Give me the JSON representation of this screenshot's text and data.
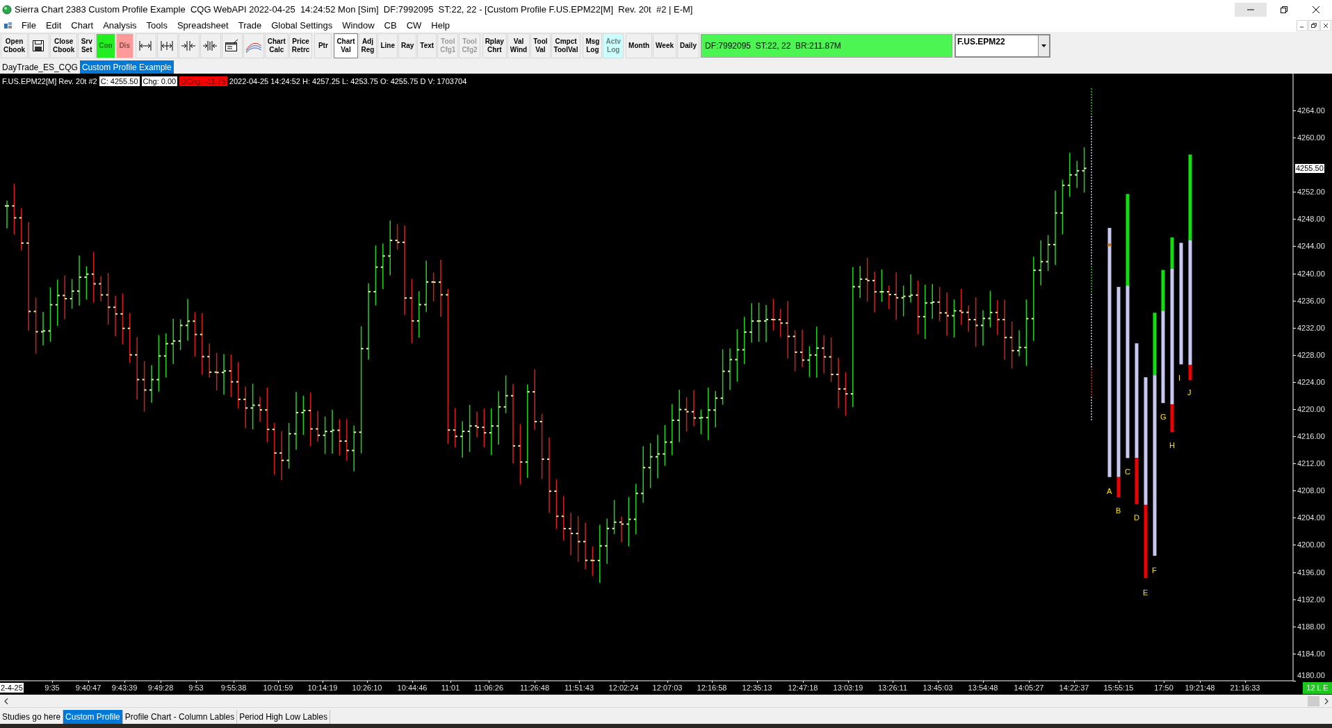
{
  "window": {
    "title": "Sierra Chart 2383 Custom Profile Example  CQG WebAPI 2022-04-25  14:24:52 Mon [Sim]  DF:7992095  ST:22, 22 - [Custom Profile F.US.EPM22[M]  Rev. 20t  #2 | E-M]"
  },
  "menu": [
    "File",
    "Edit",
    "Chart",
    "Analysis",
    "Tools",
    "Spreadsheet",
    "Trade",
    "Global Settings",
    "Window",
    "CB",
    "CW",
    "Help"
  ],
  "toolbar": {
    "groups": [
      [
        {
          "kind": "text",
          "label": "Open\nCbook",
          "pressed": false,
          "disabled": false
        },
        {
          "kind": "floppy"
        },
        {
          "kind": "text",
          "label": "Close\nCbook",
          "pressed": false,
          "disabled": false
        },
        {
          "kind": "text",
          "label": "Srv\nSet",
          "pressed": false,
          "disabled": false
        },
        {
          "kind": "text",
          "label": "Con",
          "pressed": false,
          "disabled": false,
          "color": "#22ee22"
        },
        {
          "kind": "text",
          "label": "Dis",
          "pressed": false,
          "disabled": false,
          "color": "#ff9a9a"
        }
      ],
      [
        {
          "kind": "spanout"
        },
        {
          "kind": "spanbar"
        },
        {
          "kind": "squeeze"
        },
        {
          "kind": "squeezebar"
        },
        {
          "kind": "form"
        },
        {
          "kind": "arcs"
        },
        {
          "kind": "text",
          "label": "Chart\nCalc",
          "pressed": false,
          "disabled": false
        },
        {
          "kind": "text",
          "label": "Price\nRetrc",
          "pressed": false,
          "disabled": false
        }
      ],
      [
        {
          "kind": "text",
          "label": "Ptr",
          "pressed": false,
          "disabled": false
        }
      ],
      [
        {
          "kind": "text",
          "label": "Chart\nVal",
          "pressed": true,
          "disabled": false
        },
        {
          "kind": "text",
          "label": "Adj\nReg",
          "pressed": false,
          "disabled": false
        },
        {
          "kind": "text",
          "label": "Line",
          "pressed": false,
          "disabled": false
        },
        {
          "kind": "text",
          "label": "Ray",
          "pressed": false,
          "disabled": false
        },
        {
          "kind": "text",
          "label": "Text",
          "pressed": false,
          "disabled": false
        },
        {
          "kind": "text",
          "label": "Tool\nCfg1",
          "pressed": false,
          "disabled": true
        },
        {
          "kind": "text",
          "label": "Tool\nCfg2",
          "pressed": false,
          "disabled": true
        }
      ],
      [
        {
          "kind": "text",
          "label": "Rplay\nChrt",
          "pressed": false,
          "disabled": false
        },
        {
          "kind": "text",
          "label": "Val\nWind",
          "pressed": false,
          "disabled": false
        },
        {
          "kind": "text",
          "label": "Tool\nVal",
          "pressed": false,
          "disabled": false
        },
        {
          "kind": "text",
          "label": "Cmpct\nToolVal",
          "pressed": false,
          "disabled": false
        }
      ],
      [
        {
          "kind": "text",
          "label": "Msg\nLog",
          "pressed": false,
          "disabled": false
        },
        {
          "kind": "text",
          "label": "Actv\nLog",
          "pressed": false,
          "disabled": false,
          "color": "#ccffff"
        }
      ],
      [
        {
          "kind": "text",
          "label": "Month",
          "pressed": false,
          "disabled": false
        },
        {
          "kind": "text",
          "label": "Week",
          "pressed": false,
          "disabled": false
        },
        {
          "kind": "text",
          "label": "Daily",
          "pressed": false,
          "disabled": false
        }
      ]
    ]
  },
  "status_field": "DF:7992095  ST:22, 22  BR:211.87M",
  "symbol_dropdown": {
    "value": "F.US.EPM22"
  },
  "chart_tabs": [
    {
      "label": "DayTrade_ES_CQG",
      "selected": false
    },
    {
      "label": "Custom Profile Example",
      "selected": true
    }
  ],
  "chart": {
    "header": [
      {
        "text": "F.US.EPM22[M]",
        "kind": "plain"
      },
      {
        "text": "Rev. 20t #2",
        "kind": "plain"
      },
      {
        "text": "C: 4255.50",
        "kind": "boxed"
      },
      {
        "text": "Chg: 0.00",
        "kind": "boxed"
      },
      {
        "text": "DChg: -11.75",
        "kind": "alert"
      },
      {
        "text": "2022-04-25 14:24:52 H: 4257.25 L: 4253.75 O: 4255.75 D V: 1703704",
        "kind": "plain"
      }
    ],
    "price_labels": [
      "4264.00",
      "4260.00",
      "4252.00",
      "4248.00",
      "4244.00",
      "4240.00",
      "4236.00",
      "4232.00",
      "4228.00",
      "4224.00",
      "4220.00",
      "4216.00",
      "4212.00",
      "4208.00",
      "4204.00",
      "4200.00",
      "4196.00",
      "4192.00",
      "4188.00",
      "4184.00",
      "4180.00"
    ],
    "current_price": "4255.50",
    "time_labels": [
      {
        "text": "2-4-25",
        "highlighted": true
      },
      {
        "text": "9:35",
        "highlighted": false
      },
      {
        "text": "9:40:47",
        "highlighted": false
      },
      {
        "text": "9:43:39",
        "highlighted": false
      },
      {
        "text": "9:49:28",
        "highlighted": false
      },
      {
        "text": "9:53",
        "highlighted": false
      },
      {
        "text": "9:55:38",
        "highlighted": false
      },
      {
        "text": "10:01:59",
        "highlighted": false
      },
      {
        "text": "10:14:19",
        "highlighted": false
      },
      {
        "text": "10:26:10",
        "highlighted": false
      },
      {
        "text": "10:44:46",
        "highlighted": false
      },
      {
        "text": "11:01",
        "highlighted": false
      },
      {
        "text": "11:06:26",
        "highlighted": false
      },
      {
        "text": "11:26:48",
        "highlighted": false
      },
      {
        "text": "11:51:43",
        "highlighted": false
      },
      {
        "text": "12:02:24",
        "highlighted": false
      },
      {
        "text": "12:07:03",
        "highlighted": false
      },
      {
        "text": "12:16:58",
        "highlighted": false
      },
      {
        "text": "12:35:13",
        "highlighted": false
      },
      {
        "text": "12:47:18",
        "highlighted": false
      },
      {
        "text": "13:03:19",
        "highlighted": false
      },
      {
        "text": "13:26:11",
        "highlighted": false
      },
      {
        "text": "13:45:03",
        "highlighted": false
      },
      {
        "text": "13:54:48",
        "highlighted": false
      },
      {
        "text": "14:05:27",
        "highlighted": false
      },
      {
        "text": "14:22:37",
        "highlighted": false
      },
      {
        "text": "15:55:15",
        "highlighted": false
      },
      {
        "text": "17:50",
        "highlighted": false
      },
      {
        "text": "19:21:48",
        "highlighted": false
      },
      {
        "text": "21:16:33",
        "highlighted": false
      }
    ],
    "profile_columns": [
      {
        "label": "A"
      },
      {
        "label": "B"
      },
      {
        "label": "C"
      },
      {
        "label": "D"
      },
      {
        "label": "E"
      },
      {
        "label": "F"
      },
      {
        "label": "G"
      },
      {
        "label": "H"
      },
      {
        "label": "I"
      },
      {
        "label": "J"
      }
    ],
    "status_tag": "12 L E"
  },
  "study_tabs": [
    {
      "label": "Studies go here",
      "selected": false
    },
    {
      "label": "Custom Profile",
      "selected": true
    },
    {
      "label": "Profile Chart - Column Lables",
      "selected": false
    },
    {
      "label": "Period High Low Lables",
      "selected": false
    }
  ]
}
